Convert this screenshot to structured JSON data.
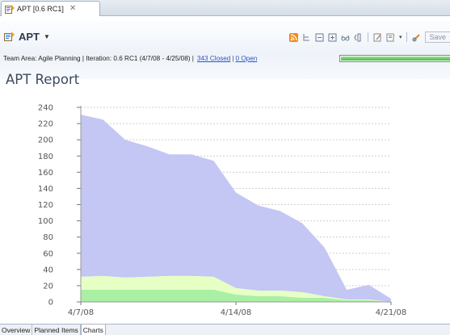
{
  "editor_tab": {
    "label": "APT [0.6 RC1]",
    "close_icon": "close-x-icon"
  },
  "header": {
    "title": "APT",
    "team_area_text": "Team Area: Agile Planning | Iteration: 0.6 RC1 (4/7/08 - 4/25/08) |",
    "closed_link": "343 Closed",
    "open_link": "0 Open",
    "progress_fraction": 1.0,
    "progress_color": "#4cb84a"
  },
  "toolbar": {
    "icons": [
      "rss-feed-icon",
      "hierarchy-icon",
      "collapse-all-icon",
      "expand-all-icon",
      "glasses-icon",
      "split-icon",
      "edit-icon",
      "new-item-icon",
      "link-icon"
    ],
    "save_label": "Save"
  },
  "report_title": "APT Report",
  "chart_data": {
    "type": "area",
    "x": [
      "4/7/08",
      "4/8/08",
      "4/9/08",
      "4/10/08",
      "4/11/08",
      "4/12/08",
      "4/13/08",
      "4/14/08",
      "4/15/08",
      "4/16/08",
      "4/17/08",
      "4/18/08",
      "4/19/08",
      "4/20/08",
      "4/21/08"
    ],
    "xticks": [
      "4/7/08",
      "4/14/08",
      "4/21/08"
    ],
    "ylim": [
      0,
      240
    ],
    "yticks": [
      0,
      20,
      40,
      60,
      80,
      100,
      120,
      140,
      160,
      180,
      200,
      220,
      240
    ],
    "grid": true,
    "stacked": true,
    "series": [
      {
        "color": "#a9f0a4",
        "values": [
          15,
          15,
          15,
          15,
          15,
          15,
          15,
          9,
          7,
          7,
          5,
          5,
          2,
          2,
          0
        ]
      },
      {
        "color": "#e6ffc4",
        "values": [
          16,
          17,
          15,
          16,
          17,
          17,
          16,
          8,
          7,
          7,
          7,
          2,
          1,
          1,
          0
        ]
      },
      {
        "color": "#c4c6f4",
        "values": [
          200,
          193,
          170,
          161,
          150,
          150,
          143,
          118,
          105,
          98,
          85,
          60,
          12,
          18,
          4
        ]
      }
    ],
    "last_point_values": [
      0,
      0,
      0
    ],
    "totals": [
      231,
      225,
      200,
      192,
      182,
      182,
      174,
      135,
      119,
      112,
      97,
      67,
      15,
      21,
      4
    ]
  },
  "bottom_tabs": [
    "Overview",
    "Planned Items",
    "Charts"
  ],
  "active_tab": "Charts"
}
